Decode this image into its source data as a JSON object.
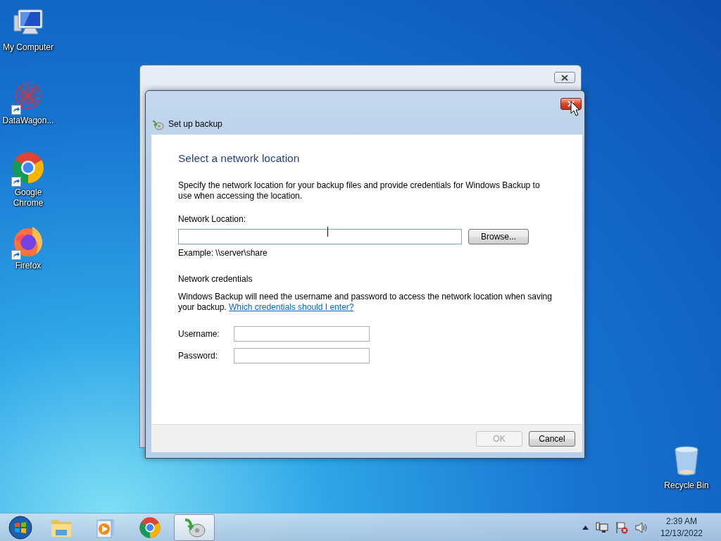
{
  "desktop_icons": [
    {
      "label": "My Computer",
      "kind": "computer",
      "shortcut": false
    },
    {
      "label": "DataWagon...",
      "kind": "network",
      "shortcut": true
    },
    {
      "label": "Google Chrome",
      "kind": "chrome",
      "shortcut": true
    },
    {
      "label": "Firefox",
      "kind": "firefox",
      "shortcut": true
    },
    {
      "label": "Recycle Bin",
      "kind": "bin",
      "shortcut": false
    }
  ],
  "dialog": {
    "title": "Set up backup",
    "heading": "Select a network location",
    "intro": "Specify the network location for your backup files and provide credentials for Windows Backup to use when accessing the location.",
    "location_label": "Network Location:",
    "location_focused": true,
    "browse_button": "Browse...",
    "example": "Example: \\\\server\\share",
    "credentials_heading": "Network credentials",
    "credentials_text": "Windows Backup will need the username and password to access the network location when saving your backup.",
    "credentials_link": "Which credentials should I enter?",
    "fields": [
      {
        "label": "Username:"
      },
      {
        "label": "Password:"
      }
    ],
    "buttons": [
      {
        "label": "OK",
        "disabled": true
      },
      {
        "label": "Cancel",
        "disabled": false
      }
    ]
  },
  "taskbar": {
    "apps": [
      {
        "kind": "explorer",
        "selected": false
      },
      {
        "kind": "media",
        "selected": false
      },
      {
        "kind": "chrome",
        "selected": false
      },
      {
        "kind": "backup",
        "selected": true
      }
    ],
    "clock": {
      "time": "2:39 AM",
      "date": "12/13/2022"
    }
  }
}
